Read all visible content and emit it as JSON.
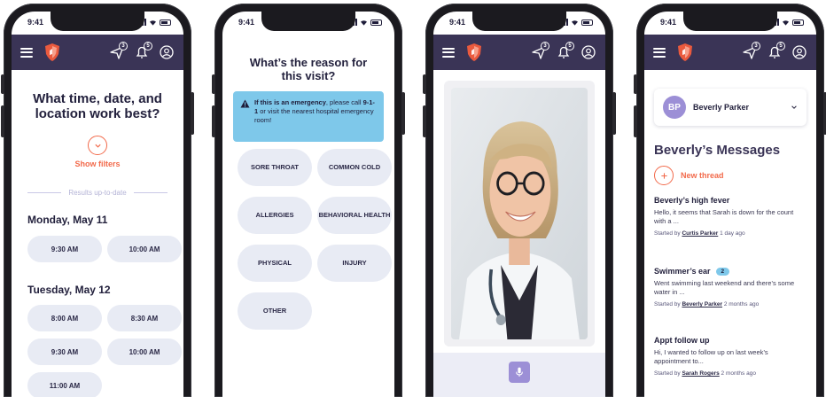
{
  "status_bar": {
    "time": "9:41"
  },
  "nav": {
    "message_count": "3",
    "notification_count": "5"
  },
  "screen1": {
    "title": "What time, date, and location work best?",
    "show_filters": "Show filters",
    "results_label": "Results up-to-date",
    "days": [
      {
        "label": "Monday, May 11",
        "slots": [
          "9:30 AM",
          "10:00 AM"
        ]
      },
      {
        "label": "Tuesday, May 12",
        "slots": [
          "8:00 AM",
          "8:30 AM",
          "9:30 AM",
          "10:00 AM",
          "11:00 AM"
        ]
      }
    ]
  },
  "screen2": {
    "title": "What’s the reason for this visit?",
    "alert": {
      "bold_lead": "If this is an emergency",
      "text_1": ", please call ",
      "phone": "9-1-1",
      "text_2": " or visit the nearest hospital emergency room!"
    },
    "reasons": [
      "SORE THROAT",
      "COMMON COLD",
      "ALLERGIES",
      "BEHAVIORAL HEALTH",
      "PHYSICAL",
      "INJURY",
      "OTHER"
    ]
  },
  "screen3": {
    "mic_icon": "microphone-icon"
  },
  "screen4": {
    "user": {
      "initials": "BP",
      "name": "Beverly Parker"
    },
    "title": "Beverly’s Messages",
    "new_thread": "New thread",
    "threads": [
      {
        "title": "Beverly’s high fever",
        "badge": "",
        "preview": "Hello, it seems that Sarah is down for the count with a ...",
        "started_by_label": "Started by",
        "author": "Curtis Parker",
        "ago": "1 day ago"
      },
      {
        "title": "Swimmer’s ear",
        "badge": "2",
        "preview": "Went swimming last weekend and there’s some water in ...",
        "started_by_label": "Started by",
        "author": "Beverly Parker",
        "ago": "2 months ago"
      },
      {
        "title": "Appt follow up",
        "badge": "",
        "preview": "Hi, I wanted to follow up on last week’s appointment to...",
        "started_by_label": "Started by",
        "author": "Sarah Rogers",
        "ago": "2 months ago"
      }
    ]
  },
  "colors": {
    "nav": "#3a3456",
    "accent": "#f26a4b",
    "chip": "#e8ebf4",
    "alert": "#7ec8ea",
    "avatar": "#9c8fd6"
  }
}
